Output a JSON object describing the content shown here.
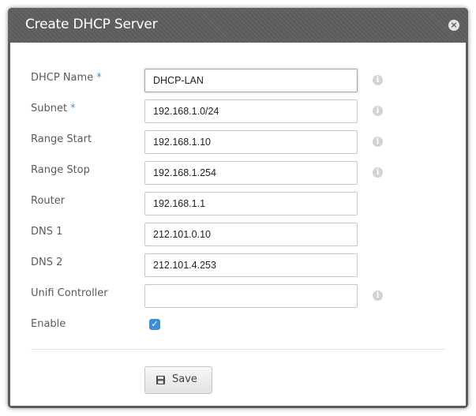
{
  "dialog": {
    "title": "Create DHCP Server",
    "close_glyph": "×"
  },
  "fields": [
    {
      "label": "DHCP Name",
      "required": "*",
      "value": "DHCP-LAN",
      "info": "i"
    },
    {
      "label": "Subnet",
      "required": "*",
      "value": "192.168.1.0/24",
      "info": "i"
    },
    {
      "label": "Range Start",
      "value": "192.168.1.10",
      "info": "i"
    },
    {
      "label": "Range Stop",
      "value": "192.168.1.254",
      "info": "i"
    },
    {
      "label": "Router",
      "value": "192.168.1.1"
    },
    {
      "label": "DNS 1",
      "value": "212.101.0.10"
    },
    {
      "label": "DNS 2",
      "value": "212.101.4.253"
    },
    {
      "label": "Unifi Controller",
      "value": "",
      "info": "i"
    }
  ],
  "enable": {
    "label": "Enable",
    "check_glyph": "✓"
  },
  "save": {
    "label": "Save",
    "icon": "floppy-disk-icon"
  },
  "colors": {
    "accent": "#3f8fd8",
    "required_star": "#4a90c8",
    "titlebar": "#5b5b5b"
  }
}
